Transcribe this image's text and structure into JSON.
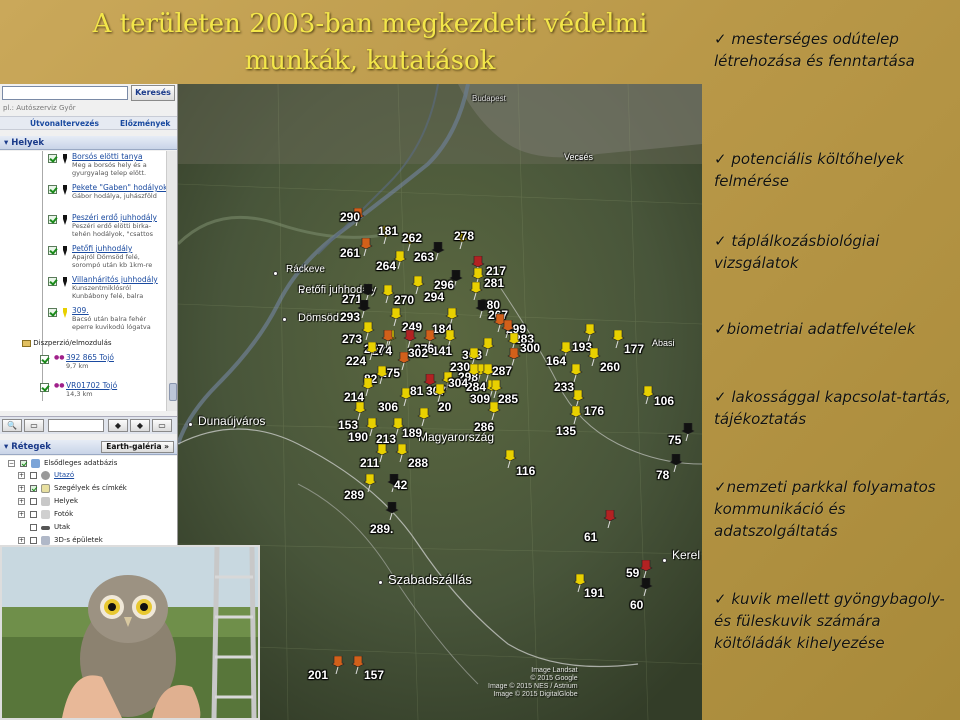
{
  "slide": {
    "title_line1": "A területen 2003-ban megkezdett védelmi",
    "title_line2": "munkák, kutatások",
    "bullets": [
      "✓ mesterséges odútelep létrehozása és fenntartása",
      "✓ potenciális költőhelyek felmérése",
      "✓ táplálkozásbiológiai vizsgálatok",
      "✓biometriai adatfelvételek",
      "✓ lakossággal kapcsolat-tartás, tájékoztatás",
      "✓nemzeti parkkal folyamatos kommunikáció és adatszolgáltatás",
      "✓ kuvik mellett gyöngybagoly- és füleskuvik számára költőládák kihelyezése"
    ],
    "colors": {
      "title": "#f3e64a",
      "background": "#b99848"
    }
  },
  "ge_panel": {
    "search_button": "Keresés",
    "search_hint": "pl.: Autószerviz Győr",
    "link_directions": "Útvonaltervezés",
    "link_history": "Előzmények",
    "places_header": "Helyek",
    "places": [
      {
        "name": "Borsós elötti tanya",
        "desc1": "Meg a borsós hely és a",
        "desc2": "gyurgyalag telep elött.",
        "pin": "black"
      },
      {
        "name": "Pekete \"Gaben\" hodályok",
        "desc1": "Gábor hodálya, juhászföld",
        "desc2": "",
        "pin": "black"
      },
      {
        "name": "Peszéri erdő juhhodály",
        "desc1": "Peszéri erdő elötti birka-",
        "desc2": "tehén hodályok, \"csattos",
        "pin": "black"
      },
      {
        "name": "Petőfi juhhodály",
        "desc1": "Apajról Dömsöd felé,",
        "desc2": "sorompó után kb 1km-re",
        "pin": "black"
      },
      {
        "name": "Villanháritós juhhodály",
        "desc1": "Kunszentmiklósról",
        "desc2": "Kunbábony felé, balra",
        "pin": "black"
      },
      {
        "name": "309.",
        "desc1": "Bacsó után balra fehér",
        "desc2": "eperre kuvikodú lógatva",
        "pin": "yellow"
      }
    ],
    "folder_name": "Diszperzió/elmozdulás",
    "tracks": [
      {
        "name": "392 865 Tojó",
        "dist": "9,7 km"
      },
      {
        "name": "VR01702 Tojó",
        "dist": "14,3 km"
      }
    ],
    "layers_header": "Rétegek",
    "earth_gallery": "Earth-galéria »",
    "layers": [
      {
        "label": "Elsődleges adatbázis",
        "indent": 0,
        "checked": true
      },
      {
        "label": "Utazó",
        "indent": 1,
        "checked": false,
        "link": true
      },
      {
        "label": "Szegélyek és címkék",
        "indent": 1,
        "checked": true
      },
      {
        "label": "Helyek",
        "indent": 1,
        "checked": false
      },
      {
        "label": "Fotók",
        "indent": 1,
        "checked": false
      },
      {
        "label": "Utak",
        "indent": 1,
        "checked": false
      },
      {
        "label": "3D-s épületek",
        "indent": 1,
        "checked": false
      }
    ]
  },
  "map": {
    "towns": {
      "budapest": "Budapest",
      "vecses": "Vecsés",
      "rackeve": "Ráckeve",
      "domsod": "Dömsöd",
      "dunaujvaros": "Dunaújváros",
      "magyarorszag": "Magyarország",
      "szabadszallas": "Szabadszállás",
      "kerek": "Kerel",
      "petofi": "Petőfi juhhodály",
      "abasi": "Abasi"
    },
    "markers": [
      "290",
      "181",
      "261",
      "262",
      "278",
      "263",
      "217",
      "264",
      "294",
      "296",
      "281",
      "271",
      "270",
      "280",
      "293",
      "249",
      "274",
      "184",
      "267",
      "299",
      "273",
      "277",
      "141",
      "276",
      "302",
      "283",
      "193",
      "177",
      "224",
      "275",
      "303",
      "300",
      "164",
      "260",
      "287",
      "82",
      "214",
      "230",
      "298",
      "284",
      "233",
      "306",
      "81",
      "307",
      "304",
      "20",
      "189",
      "285",
      "176",
      "106",
      "135",
      "309",
      "286",
      "153",
      "190",
      "213",
      "116",
      "75",
      "211",
      "288",
      "78",
      "289",
      "42",
      "289.",
      "61",
      "59",
      "191",
      "60",
      "201",
      "157"
    ],
    "copyright_line1": "Image Landsat",
    "copyright_line2": "© 2015 Google",
    "copyright_line3": "Image © 2015 NES / Astrium",
    "copyright_line4": "Image © 2015 DigitalGlobe"
  }
}
